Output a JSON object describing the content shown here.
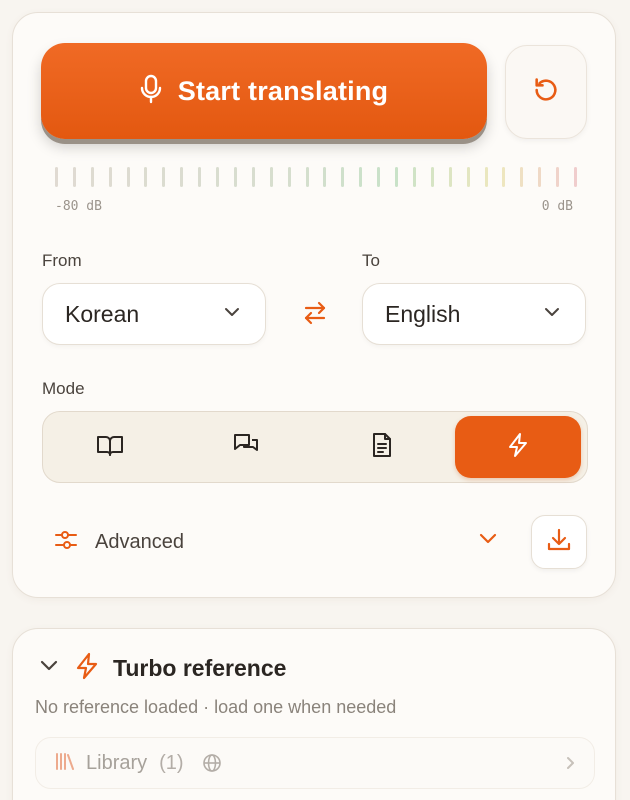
{
  "translate": {
    "start_label": "Start translating",
    "mic_icon": "microphone-icon",
    "reset_icon": "rotate-ccw-icon"
  },
  "meter": {
    "min_label": "-80 dB",
    "max_label": "0 dB"
  },
  "languages": {
    "from_label": "From",
    "from_value": "Korean",
    "to_label": "To",
    "to_value": "English"
  },
  "mode": {
    "label": "Mode",
    "options": [
      {
        "icon": "book-open-icon",
        "active": false
      },
      {
        "icon": "chat-bubbles-icon",
        "active": false
      },
      {
        "icon": "document-icon",
        "active": false
      },
      {
        "icon": "lightning-icon",
        "active": true
      }
    ]
  },
  "advanced": {
    "label": "Advanced"
  },
  "reference": {
    "title": "Turbo reference",
    "subtitle": "No reference loaded · load one when needed",
    "library_label": "Library",
    "library_count": "(1)"
  },
  "colors": {
    "accent": "#e85c14",
    "card_bg": "#fdfbf8",
    "page_bg": "#f8f5f0"
  }
}
